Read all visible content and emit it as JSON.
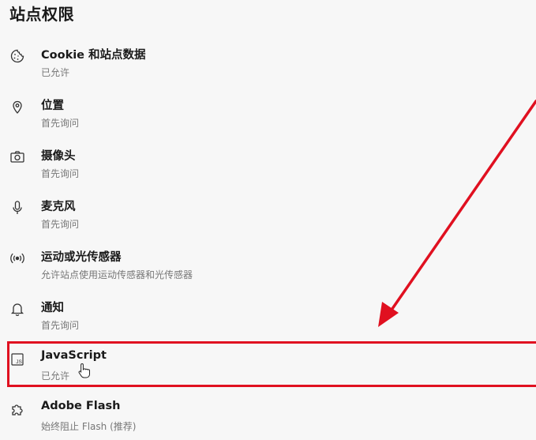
{
  "page": {
    "title": "站点权限"
  },
  "permissions": [
    {
      "icon": "cookie-icon",
      "title": "Cookie 和站点数据",
      "status": "已允许"
    },
    {
      "icon": "location-pin-icon",
      "title": "位置",
      "status": "首先询问"
    },
    {
      "icon": "camera-icon",
      "title": "摄像头",
      "status": "首先询问"
    },
    {
      "icon": "microphone-icon",
      "title": "麦克风",
      "status": "首先询问"
    },
    {
      "icon": "motion-sensor-icon",
      "title": "运动或光传感器",
      "status": "允许站点使用运动传感器和光传感器"
    },
    {
      "icon": "bell-icon",
      "title": "通知",
      "status": "首先询问"
    },
    {
      "icon": "javascript-icon",
      "title": "JavaScript",
      "status": "已允许"
    },
    {
      "icon": "puzzle-piece-icon",
      "title": "Adobe Flash",
      "status": "始终阻止 Flash (推荐)"
    }
  ],
  "annotation": {
    "highlight_color": "#e01020",
    "highlighted_item": "JavaScript"
  }
}
